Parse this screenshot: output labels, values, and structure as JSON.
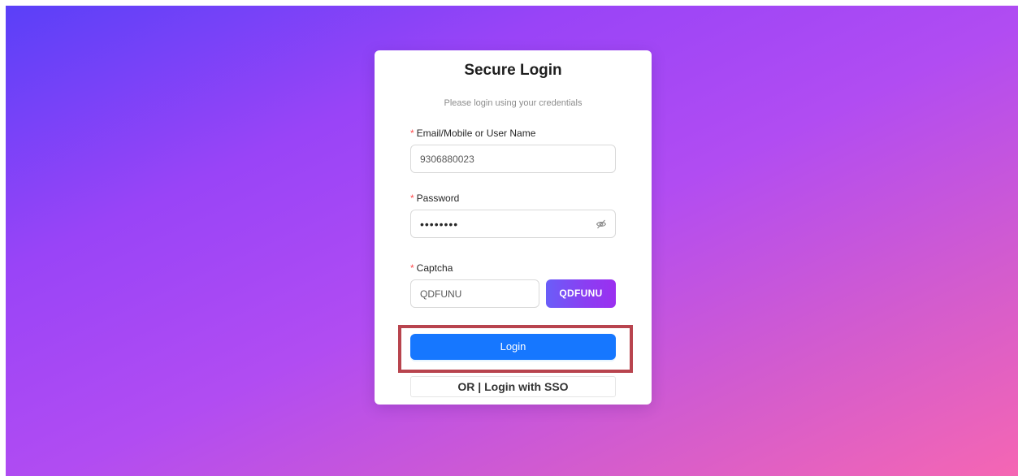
{
  "login": {
    "title": "Secure Login",
    "subtitle": "Please login using your credentials",
    "required_marker": "*",
    "email": {
      "label": "Email/Mobile or User Name",
      "value": "9306880023"
    },
    "password": {
      "label": "Password",
      "masked_value": "••••••••",
      "visibility_icon": "eye-invisible-icon"
    },
    "captcha": {
      "label": "Captcha",
      "input_value": "QDFUNU",
      "code": "QDFUNU"
    },
    "login_button": "Login",
    "sso_button": "OR | Login with SSO"
  },
  "colors": {
    "primary": "#1677ff",
    "required": "#ff4d4f",
    "highlight_border": "#b8444e",
    "background_start": "#5a40f8",
    "background_end": "#f566b3"
  }
}
